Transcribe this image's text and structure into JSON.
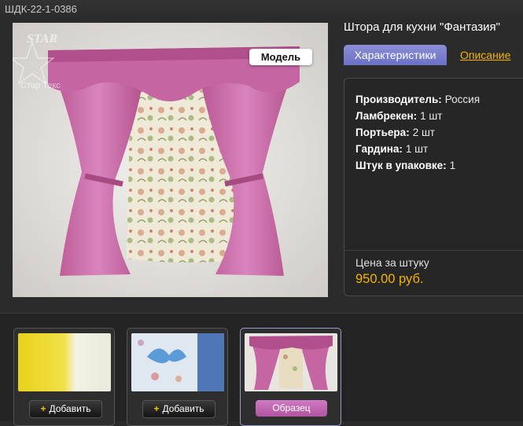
{
  "sku": "ШДК-22-1-0386",
  "product": {
    "title": "Штора для кухни \"Фантазия\"",
    "badge": "Модель",
    "watermark": "STAR Tex Стар Текс"
  },
  "tabs": {
    "specs_label": "Характеристики",
    "description_label": "Описание"
  },
  "specs": [
    {
      "label": "Производитель:",
      "value": "Россия"
    },
    {
      "label": "Ламбрекен:",
      "value": "1 шт"
    },
    {
      "label": "Портьера:",
      "value": "2 шт"
    },
    {
      "label": "Гардина:",
      "value": "1 шт"
    },
    {
      "label": "Штук в упаковке:",
      "value": "1"
    }
  ],
  "price": {
    "label": "Цена за штуку",
    "value": "950.00 руб."
  },
  "thumbnails": [
    {
      "button": "Добавить",
      "plus": "+"
    },
    {
      "button": "Добавить",
      "plus": "+"
    },
    {
      "button": "Образец"
    }
  ],
  "colors": {
    "accent_yellow": "#f4b400",
    "tab_purple": "#7a7fcf",
    "curtain_pink": "#c86aa8",
    "sample_pink": "#c268b3"
  }
}
